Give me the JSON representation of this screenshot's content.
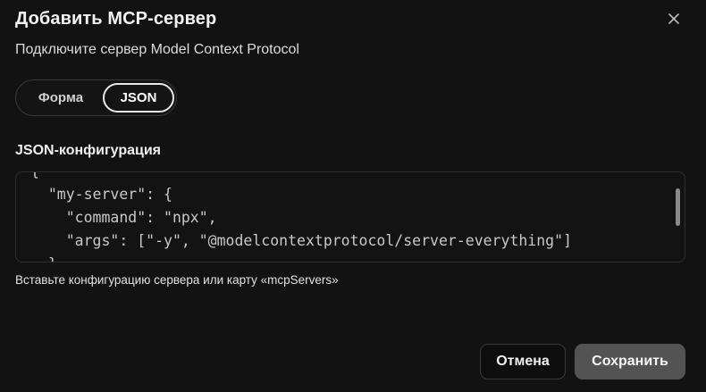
{
  "dialog": {
    "title": "Добавить MCP-сервер",
    "subtitle": "Подключите сервер Model Context Protocol",
    "close_icon": "close-icon"
  },
  "mode_toggle": {
    "options": [
      "Форма",
      "JSON"
    ],
    "selected": "JSON"
  },
  "json_config": {
    "label": "JSON-конфигурация",
    "visible_lines": [
      "{",
      "  \"my-server\": {",
      "    \"command\": \"npx\",",
      "    \"args\": [\"-y\", \"@modelcontextprotocol/server-everything\"]",
      "  }"
    ],
    "helper_text": "Вставьте конфигурацию сервера или карту «mcpServers»"
  },
  "actions": {
    "cancel_label": "Отмена",
    "save_label": "Сохранить"
  },
  "colors": {
    "background": "#121212",
    "save_button": "#535353",
    "border": "#3a3a3a"
  }
}
